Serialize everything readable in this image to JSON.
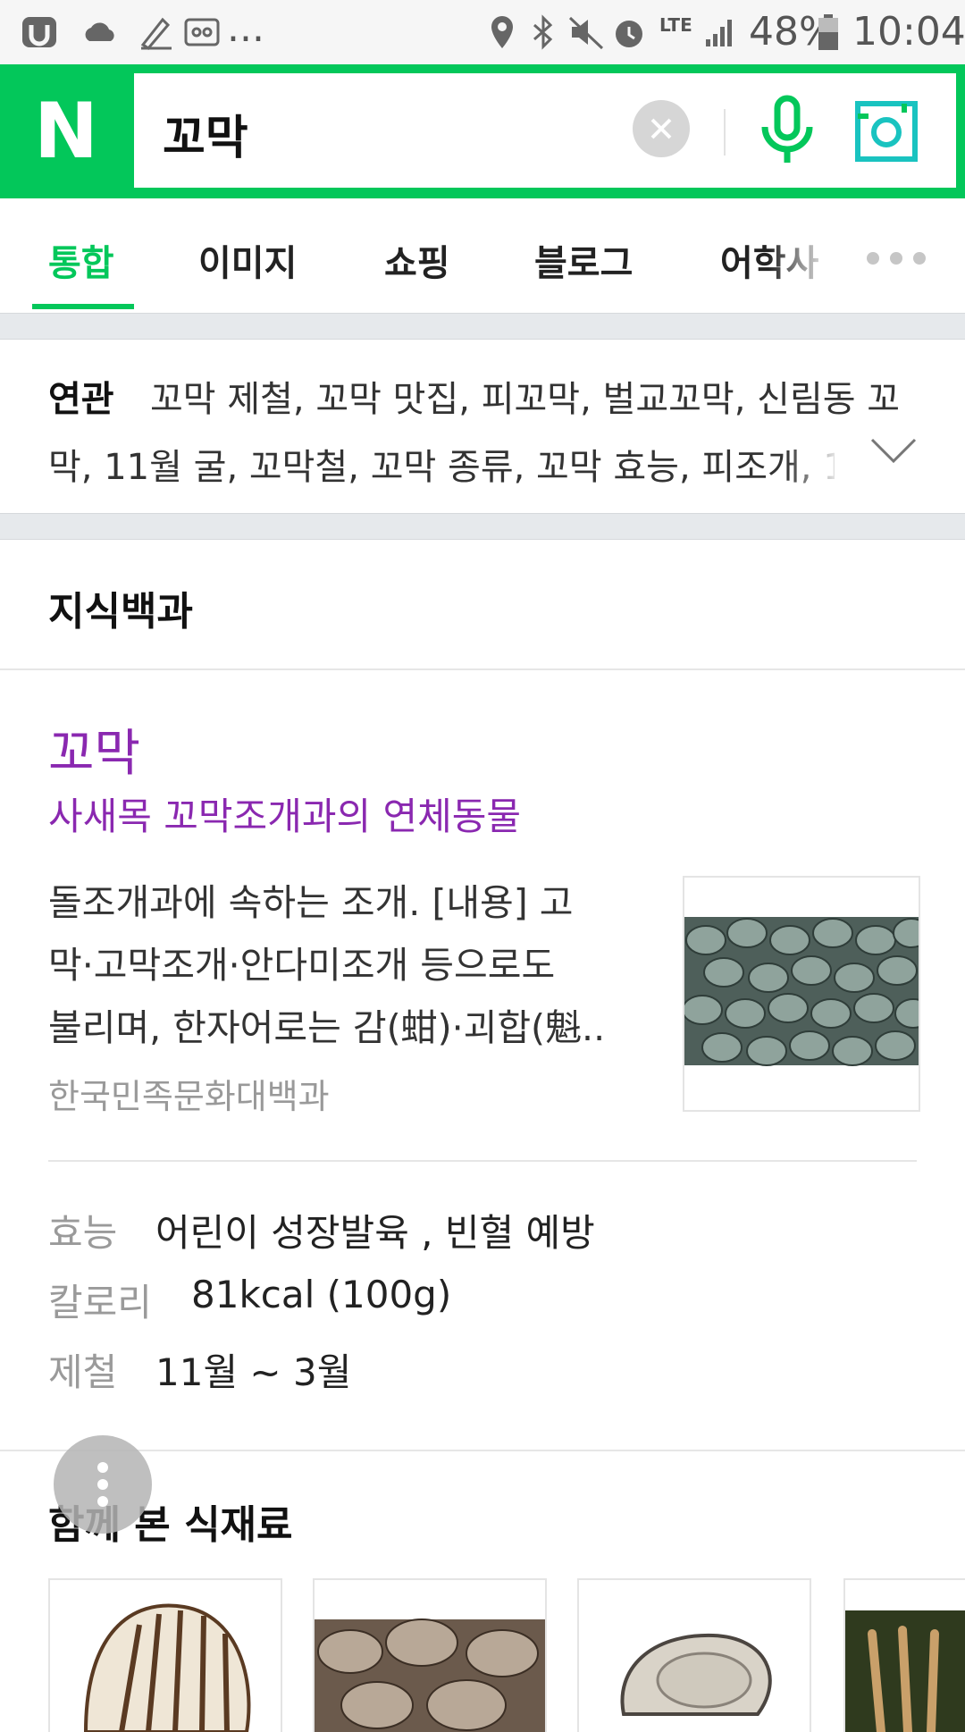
{
  "status_bar": {
    "more_indicator": "...",
    "lte_label": "LTE",
    "battery": "48%",
    "time": "10:04"
  },
  "search": {
    "query": "꼬막",
    "logo": "N"
  },
  "tabs": [
    {
      "label": "통합",
      "active": true
    },
    {
      "label": "이미지"
    },
    {
      "label": "쇼핑"
    },
    {
      "label": "블로그"
    },
    {
      "label": "어학사"
    }
  ],
  "related": {
    "label": "연관",
    "line1": "꼬막 제철, 꼬막 맛집, 피꼬막, 벌교꼬막, 신림동 꼬",
    "line2": "막, 11월 굴, 꼬막철, 꼬막 종류, 꼬막 효능, 피조개, 1"
  },
  "knowledge": {
    "section_title": "지식백과",
    "entry_title": "꼬막",
    "entry_subtitle": "사새목 꼬막조개과의 연체동물",
    "description_lines": [
      "돌조개과에 속하는 조개. [내용] 고",
      "막·고막조개·안다미조개 등으로도",
      "불리며, 한자어로는 감(蚶)·괴합(魁.."
    ],
    "source": "한국민족문화대백과",
    "facts": [
      {
        "label": "효능",
        "value": "어린이 성장발육 , 빈혈 예방"
      },
      {
        "label": "칼로리",
        "value": "81kcal (100g)"
      },
      {
        "label": "제철",
        "value": "11월 ~ 3월"
      }
    ]
  },
  "related_ingredients": {
    "title": "함께 본 식재료"
  },
  "colors": {
    "brand_green": "#03c75a",
    "link_purple": "#8a28b0"
  }
}
